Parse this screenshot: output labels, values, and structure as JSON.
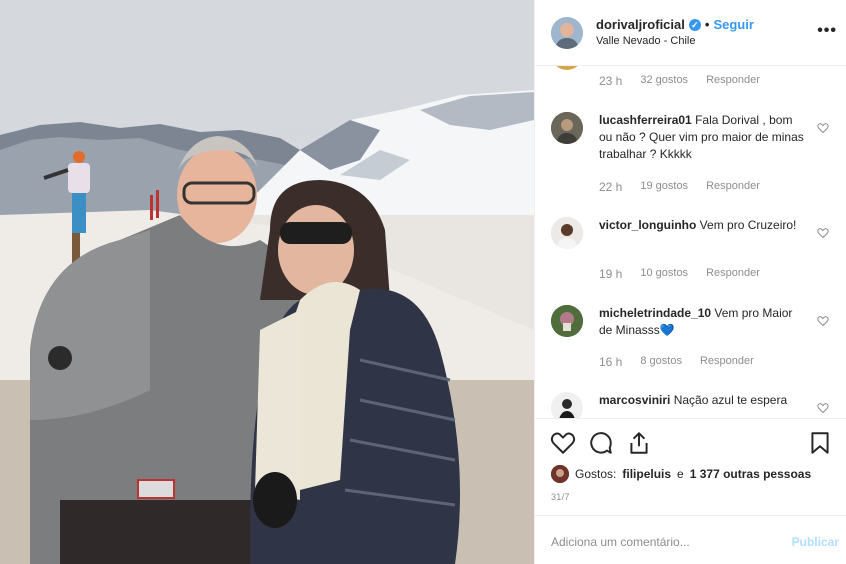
{
  "post": {
    "username": "dorivaljroficial",
    "separator": "•",
    "follow_label": "Seguir",
    "location": "Valle Nevado - Chile",
    "more_label": "•••"
  },
  "comments": [
    {
      "username": "",
      "text": "",
      "time": "23 h",
      "likes": "32 gostos",
      "reply": "Responder"
    },
    {
      "username": "lucashferreira01",
      "text": " Fala Dorival , bom ou não ? Quer vim pro maior de minas trabalhar ? Kkkkk",
      "time": "22 h",
      "likes": "19 gostos",
      "reply": "Responder"
    },
    {
      "username": "victor_longuinho",
      "text": " Vem pro Cruzeiro!",
      "time": "19 h",
      "likes": "10 gostos",
      "reply": "Responder"
    },
    {
      "username": "micheletrindade_10",
      "text": " Vem pro Maior de Minasss💙",
      "time": "16 h",
      "likes": "8 gostos",
      "reply": "Responder"
    },
    {
      "username": "marcosviniri",
      "text": " Nação azul te espera",
      "time": "",
      "likes": "",
      "reply": ""
    }
  ],
  "likes": {
    "prefix": "Gostos:",
    "user": "filipeluis",
    "middle": "e",
    "others": "1 377 outras pessoas"
  },
  "date": "31/7",
  "add_comment": {
    "placeholder": "Adiciona um comentário...",
    "publish_label": "Publicar"
  },
  "icons": [
    "verified-icon",
    "more-icon",
    "heart-icon",
    "comment-icon",
    "share-icon",
    "bookmark-icon"
  ],
  "colors": {
    "accent": "#3897f0",
    "text": "#262626",
    "muted": "#8e8e8e",
    "publish_disabled": "#b2dffc"
  }
}
